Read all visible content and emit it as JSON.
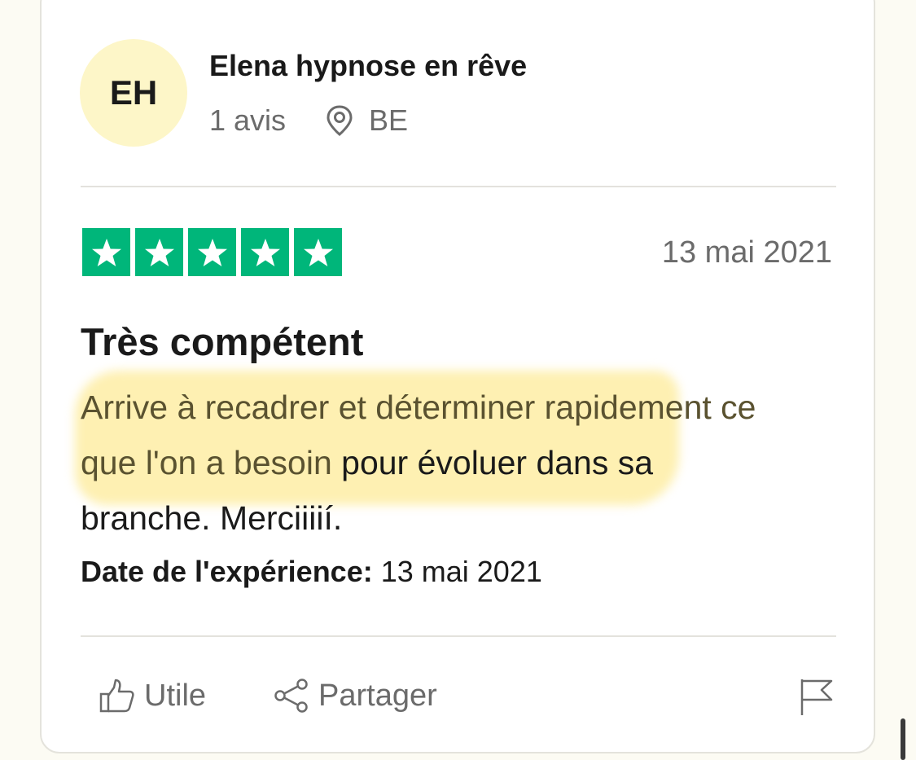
{
  "reviewer": {
    "initials": "EH",
    "name": "Elena hypnose en rêve",
    "review_count": "1 avis",
    "country": "BE",
    "avatar_color": "#fdf6c8"
  },
  "review": {
    "rating": 5,
    "rating_max": 5,
    "star_color": "#00b67a",
    "date": "13 mai 2021",
    "title": "Très compétent",
    "body_highlighted": "Arrive à recadrer et déterminer rapidement ce que l'on a besoin",
    "body_rest": " pour évoluer dans sa branche. Merciiiií.",
    "highlight_color": "#fef0b2",
    "experience_label": "Date de l'expérience:",
    "experience_date": "13 mai 2021"
  },
  "actions": {
    "useful_label": "Utile",
    "share_label": "Partager",
    "useful_icon": "thumbs-up-icon",
    "share_icon": "share-icon",
    "report_icon": "flag-icon"
  }
}
